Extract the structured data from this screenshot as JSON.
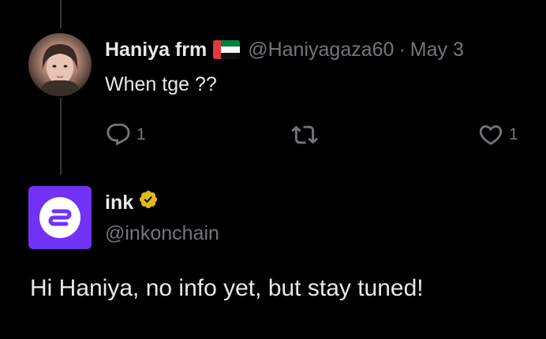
{
  "reply": {
    "display_name": "Haniya frm",
    "flag": "uae-flag-icon",
    "handle": "@Haniyagaza60",
    "separator": "·",
    "date": "May 3",
    "text": "When tge ??",
    "actions": {
      "comment_count": "1",
      "like_count": "1"
    }
  },
  "post": {
    "author_name": "ink",
    "author_handle": "@inkonchain",
    "verified": "gold-verified-badge-icon",
    "text": "Hi Haniya, no info yet, but stay tuned!"
  },
  "colors": {
    "background": "#000000",
    "text_primary": "#e7e9ea",
    "text_secondary": "#71767b",
    "thread_line": "#333639",
    "ink_brand": "#7132f5",
    "verified_gold": "#e2b719"
  }
}
